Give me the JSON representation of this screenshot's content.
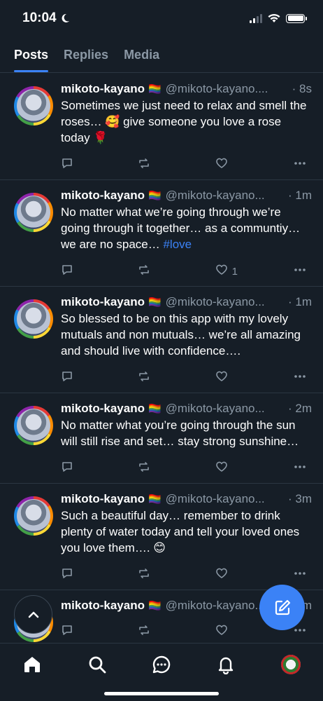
{
  "status": {
    "time": "10:04"
  },
  "tabs": [
    {
      "label": "Posts",
      "active": true
    },
    {
      "label": "Replies",
      "active": false
    },
    {
      "label": "Media",
      "active": false
    }
  ],
  "posts": [
    {
      "author": "mikoto-kayano",
      "flag": "🏳️‍🌈",
      "handle": "@mikoto-kayano....",
      "time": "· 8s",
      "text": "Sometimes we just need to relax and smell the roses… 🥰 give someone you love a rose today 🌹",
      "hashtag": "",
      "likes": ""
    },
    {
      "author": "mikoto-kayano",
      "flag": "🏳️‍🌈",
      "handle": "@mikoto-kayano...",
      "time": "· 1m",
      "text": "No matter what we’re going through we’re going through it together… as a communtiy… we are no space… ",
      "hashtag": "#love",
      "likes": "1"
    },
    {
      "author": "mikoto-kayano",
      "flag": "🏳️‍🌈",
      "handle": "@mikoto-kayano...",
      "time": "· 1m",
      "text": "So blessed to be on this app with my lovely mutuals and non mutuals… we’re all amazing and should live with confidence….",
      "hashtag": "",
      "likes": ""
    },
    {
      "author": "mikoto-kayano",
      "flag": "🏳️‍🌈",
      "handle": "@mikoto-kayano...",
      "time": "· 2m",
      "text": "No matter what you’re going through the sun will still rise and set… stay strong sunshine…",
      "hashtag": "",
      "likes": ""
    },
    {
      "author": "mikoto-kayano",
      "flag": "🏳️‍🌈",
      "handle": "@mikoto-kayano...",
      "time": "· 3m",
      "text": "Such a beautiful day… remember to drink plenty of water today and tell your loved ones you love them…. 😊",
      "hashtag": "",
      "likes": ""
    },
    {
      "author": "mikoto-kayano",
      "flag": "🏳️‍🌈",
      "handle": "@mikoto-kayano...",
      "time": "· 6m",
      "text": "",
      "hashtag": "",
      "likes": ""
    }
  ],
  "icons": {
    "reply": "reply-icon",
    "repost": "repost-icon",
    "like": "heart-icon",
    "more": "more-icon",
    "home": "home-icon",
    "search": "search-icon",
    "chat": "chat-icon",
    "notifications": "bell-icon",
    "compose": "compose-icon",
    "scroll_top": "chevron-up-icon"
  },
  "colors": {
    "accent": "#3b82f6",
    "background": "#161e27",
    "muted": "#8b98a5"
  }
}
